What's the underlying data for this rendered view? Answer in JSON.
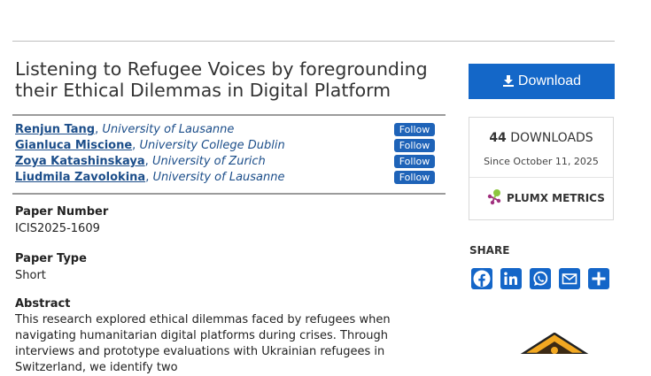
{
  "paper": {
    "title": "Listening to Refugee Voices by foregrounding their Ethical Dilemmas in Digital Platform",
    "follow_label": "Follow",
    "authors": [
      {
        "name": "Renjun Tang",
        "sep": ", ",
        "affiliation": "University of Lausanne"
      },
      {
        "name": "Gianluca Miscione",
        "sep": ", ",
        "affiliation": "University College Dublin"
      },
      {
        "name": "Zoya Katashinskaya",
        "sep": ", ",
        "affiliation": "University of Zurich"
      },
      {
        "name": "Liudmila Zavolokina",
        "sep": ", ",
        "affiliation": "University of Lausanne"
      }
    ],
    "number_label": "Paper Number",
    "number_value": "ICIS2025-1609",
    "type_label": "Paper Type",
    "type_value": "Short",
    "abstract_label": "Abstract",
    "abstract_text": "This research explored ethical dilemmas faced by refugees when navigating humanitarian digital platforms during crises. Through interviews and prototype evaluations with Ukrainian refugees in Switzerland, we identify two"
  },
  "sidebar": {
    "download_label": "Download",
    "downloads_count": "44",
    "downloads_label": "DOWNLOADS",
    "since_text": "Since October 11, 2025",
    "plumx_label": "PLUMX METRICS",
    "share_label": "SHARE",
    "share_icons": [
      "facebook-icon",
      "linkedin-icon",
      "whatsapp-icon",
      "email-icon",
      "share-plus-icon"
    ]
  },
  "colors": {
    "accent": "#1467c8",
    "link": "#1c4e8a",
    "follow": "#1e63b8"
  }
}
